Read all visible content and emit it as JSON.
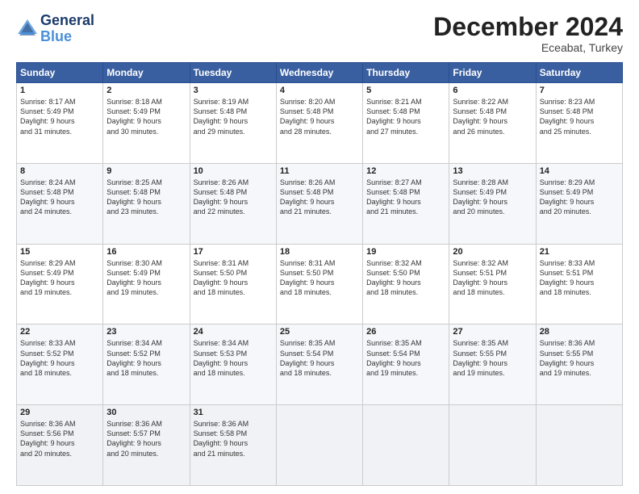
{
  "header": {
    "logo_line1": "General",
    "logo_line2": "Blue",
    "month": "December 2024",
    "location": "Eceabat, Turkey"
  },
  "days_of_week": [
    "Sunday",
    "Monday",
    "Tuesday",
    "Wednesday",
    "Thursday",
    "Friday",
    "Saturday"
  ],
  "weeks": [
    [
      {
        "day": "1",
        "text": "Sunrise: 8:17 AM\nSunset: 5:49 PM\nDaylight: 9 hours\nand 31 minutes."
      },
      {
        "day": "2",
        "text": "Sunrise: 8:18 AM\nSunset: 5:49 PM\nDaylight: 9 hours\nand 30 minutes."
      },
      {
        "day": "3",
        "text": "Sunrise: 8:19 AM\nSunset: 5:48 PM\nDaylight: 9 hours\nand 29 minutes."
      },
      {
        "day": "4",
        "text": "Sunrise: 8:20 AM\nSunset: 5:48 PM\nDaylight: 9 hours\nand 28 minutes."
      },
      {
        "day": "5",
        "text": "Sunrise: 8:21 AM\nSunset: 5:48 PM\nDaylight: 9 hours\nand 27 minutes."
      },
      {
        "day": "6",
        "text": "Sunrise: 8:22 AM\nSunset: 5:48 PM\nDaylight: 9 hours\nand 26 minutes."
      },
      {
        "day": "7",
        "text": "Sunrise: 8:23 AM\nSunset: 5:48 PM\nDaylight: 9 hours\nand 25 minutes."
      }
    ],
    [
      {
        "day": "8",
        "text": "Sunrise: 8:24 AM\nSunset: 5:48 PM\nDaylight: 9 hours\nand 24 minutes."
      },
      {
        "day": "9",
        "text": "Sunrise: 8:25 AM\nSunset: 5:48 PM\nDaylight: 9 hours\nand 23 minutes."
      },
      {
        "day": "10",
        "text": "Sunrise: 8:26 AM\nSunset: 5:48 PM\nDaylight: 9 hours\nand 22 minutes."
      },
      {
        "day": "11",
        "text": "Sunrise: 8:26 AM\nSunset: 5:48 PM\nDaylight: 9 hours\nand 21 minutes."
      },
      {
        "day": "12",
        "text": "Sunrise: 8:27 AM\nSunset: 5:48 PM\nDaylight: 9 hours\nand 21 minutes."
      },
      {
        "day": "13",
        "text": "Sunrise: 8:28 AM\nSunset: 5:49 PM\nDaylight: 9 hours\nand 20 minutes."
      },
      {
        "day": "14",
        "text": "Sunrise: 8:29 AM\nSunset: 5:49 PM\nDaylight: 9 hours\nand 20 minutes."
      }
    ],
    [
      {
        "day": "15",
        "text": "Sunrise: 8:29 AM\nSunset: 5:49 PM\nDaylight: 9 hours\nand 19 minutes."
      },
      {
        "day": "16",
        "text": "Sunrise: 8:30 AM\nSunset: 5:49 PM\nDaylight: 9 hours\nand 19 minutes."
      },
      {
        "day": "17",
        "text": "Sunrise: 8:31 AM\nSunset: 5:50 PM\nDaylight: 9 hours\nand 18 minutes."
      },
      {
        "day": "18",
        "text": "Sunrise: 8:31 AM\nSunset: 5:50 PM\nDaylight: 9 hours\nand 18 minutes."
      },
      {
        "day": "19",
        "text": "Sunrise: 8:32 AM\nSunset: 5:50 PM\nDaylight: 9 hours\nand 18 minutes."
      },
      {
        "day": "20",
        "text": "Sunrise: 8:32 AM\nSunset: 5:51 PM\nDaylight: 9 hours\nand 18 minutes."
      },
      {
        "day": "21",
        "text": "Sunrise: 8:33 AM\nSunset: 5:51 PM\nDaylight: 9 hours\nand 18 minutes."
      }
    ],
    [
      {
        "day": "22",
        "text": "Sunrise: 8:33 AM\nSunset: 5:52 PM\nDaylight: 9 hours\nand 18 minutes."
      },
      {
        "day": "23",
        "text": "Sunrise: 8:34 AM\nSunset: 5:52 PM\nDaylight: 9 hours\nand 18 minutes."
      },
      {
        "day": "24",
        "text": "Sunrise: 8:34 AM\nSunset: 5:53 PM\nDaylight: 9 hours\nand 18 minutes."
      },
      {
        "day": "25",
        "text": "Sunrise: 8:35 AM\nSunset: 5:54 PM\nDaylight: 9 hours\nand 18 minutes."
      },
      {
        "day": "26",
        "text": "Sunrise: 8:35 AM\nSunset: 5:54 PM\nDaylight: 9 hours\nand 19 minutes."
      },
      {
        "day": "27",
        "text": "Sunrise: 8:35 AM\nSunset: 5:55 PM\nDaylight: 9 hours\nand 19 minutes."
      },
      {
        "day": "28",
        "text": "Sunrise: 8:36 AM\nSunset: 5:55 PM\nDaylight: 9 hours\nand 19 minutes."
      }
    ],
    [
      {
        "day": "29",
        "text": "Sunrise: 8:36 AM\nSunset: 5:56 PM\nDaylight: 9 hours\nand 20 minutes."
      },
      {
        "day": "30",
        "text": "Sunrise: 8:36 AM\nSunset: 5:57 PM\nDaylight: 9 hours\nand 20 minutes."
      },
      {
        "day": "31",
        "text": "Sunrise: 8:36 AM\nSunset: 5:58 PM\nDaylight: 9 hours\nand 21 minutes."
      },
      {
        "day": "",
        "text": ""
      },
      {
        "day": "",
        "text": ""
      },
      {
        "day": "",
        "text": ""
      },
      {
        "day": "",
        "text": ""
      }
    ]
  ]
}
